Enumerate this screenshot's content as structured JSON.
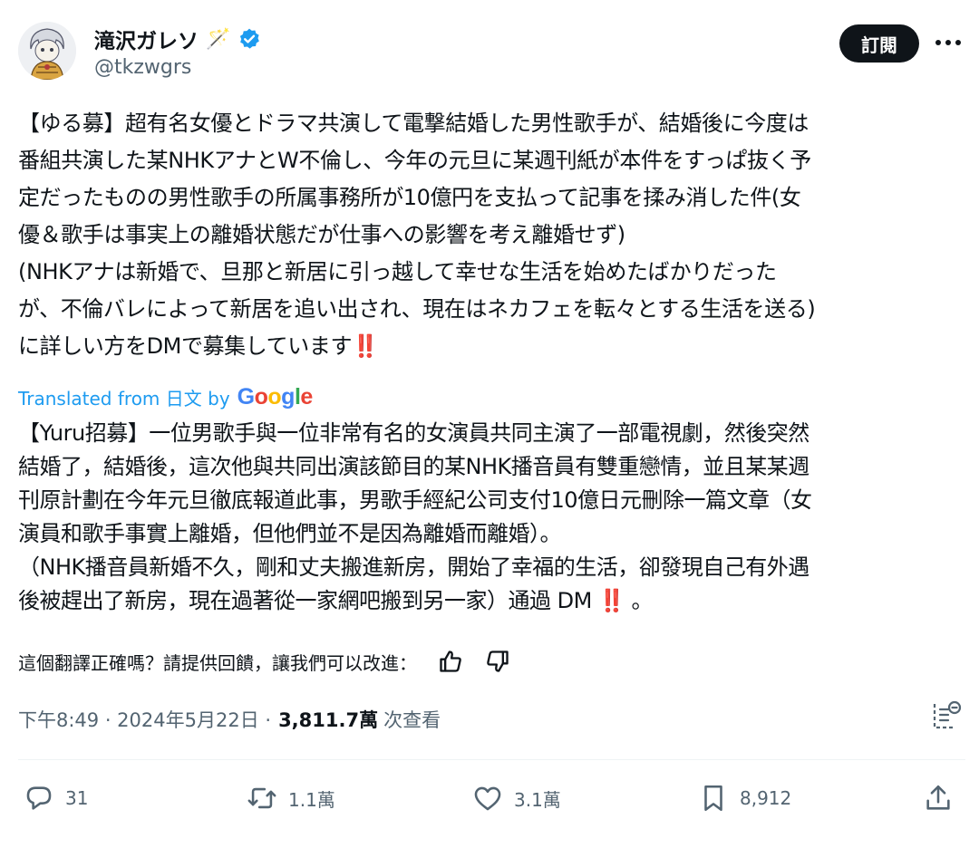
{
  "author": {
    "name": "滝沢ガレソ",
    "name_emoji": "🪄",
    "handle": "@tkzwgrs",
    "verified": true,
    "verified_color": "#1d9bf0"
  },
  "follow_label": "訂閱",
  "tweet_lines": [
    "【ゆる募】超有名女優とドラマ共演して電撃結婚した男性歌手が、結婚後に今度は",
    "番組共演した某NHKアナとW不倫し、今年の元旦に某週刊紙が本件をすっぱ抜く予",
    "定だったものの男性歌手の所属事務所が10億円を支払って記事を揉み消した件(女",
    "優＆歌手は事実上の離婚状態だが仕事への影響を考え離婚せず)",
    "(NHKアナは新婚で、旦那と新居に引っ越して幸せな生活を始めたばかりだった",
    "が、不倫バレによって新居を追い出され、現在はネカフェを転々とする生活を送る)",
    "に詳しい方をDMで募集しています"
  ],
  "tweet_end_emoji": "‼️",
  "translated_label": "Translated from 日文 by",
  "translated_brand": "Google",
  "translated_lines": [
    "【Yuru招募】一位男歌手與一位非常有名的女演員共同主演了一部電視劇，然後突然",
    "結婚了，結婚後，這次他與共同出演該節目的某NHK播音員有雙重戀情，並且某某週",
    "刊原計劃在今年元旦徹底報道此事，男歌手經紀公司支付10億日元刪除一篇文章（女",
    "演員和歌手事實上離婚，但他們並不是因為離婚而離婚）。",
    "（NHK播音員新婚不久，剛和丈夫搬進新房，開始了幸福的生活，卻發現自己有外遇",
    "後被趕出了新房，現在過著從一家網吧搬到另一家）通過 DM"
  ],
  "translated_end_emoji": "‼️",
  "translated_end_suffix": "。",
  "feedback_prompt": "這個翻譯正確嗎？請提供回饋，讓我們可以改進：",
  "timestamp": "下午8:49 · 2024年5月22日 ·",
  "views_count": "3,811.7萬",
  "views_label": "次查看",
  "actions": {
    "replies": "31",
    "reposts": "1.1萬",
    "likes": "3.1萬",
    "bookmarks": "8,912"
  },
  "colors": {
    "text": "#0f1419",
    "secondary": "#536471",
    "link": "#1d9bf0",
    "button_bg": "#0f1419",
    "divider": "#eff3f4"
  }
}
